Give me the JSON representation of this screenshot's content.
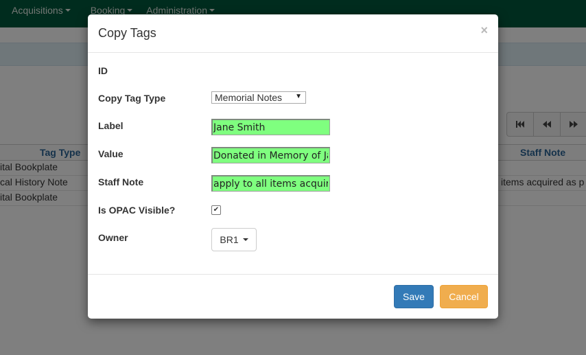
{
  "navbar": {
    "items": [
      {
        "label": "Acquisitions"
      },
      {
        "label": "Booking"
      },
      {
        "label": "Administration"
      }
    ]
  },
  "grid": {
    "headers": {
      "tag_type": "Tag Type",
      "staff_note": "Staff Note"
    },
    "rows": [
      {
        "tag_type": "ital Bookplate",
        "staff_note": ""
      },
      {
        "tag_type": "cal History Note",
        "staff_note": "items acquired as p"
      },
      {
        "tag_type": "ital Bookplate",
        "staff_note": ""
      }
    ]
  },
  "modal": {
    "title": "Copy Tags",
    "close_glyph": "×",
    "fields": {
      "id_label": "ID",
      "copy_tag_type_label": "Copy Tag Type",
      "copy_tag_type_value": "Memorial Notes",
      "label_label": "Label",
      "label_value": "Jane Smith",
      "value_label": "Value",
      "value_value": "Donated in Memory of Jane",
      "staff_note_label": "Staff Note",
      "staff_note_value": "apply to all items acquired",
      "opac_visible_label": "Is OPAC Visible?",
      "opac_visible_checked": true,
      "owner_label": "Owner",
      "owner_value": "BR1"
    },
    "footer": {
      "save_label": "Save",
      "cancel_label": "Cancel"
    }
  },
  "colors": {
    "navbar": "#00593d",
    "field_highlight": "#7fff7f",
    "save": "#337ab7",
    "cancel": "#f0ad4e"
  }
}
